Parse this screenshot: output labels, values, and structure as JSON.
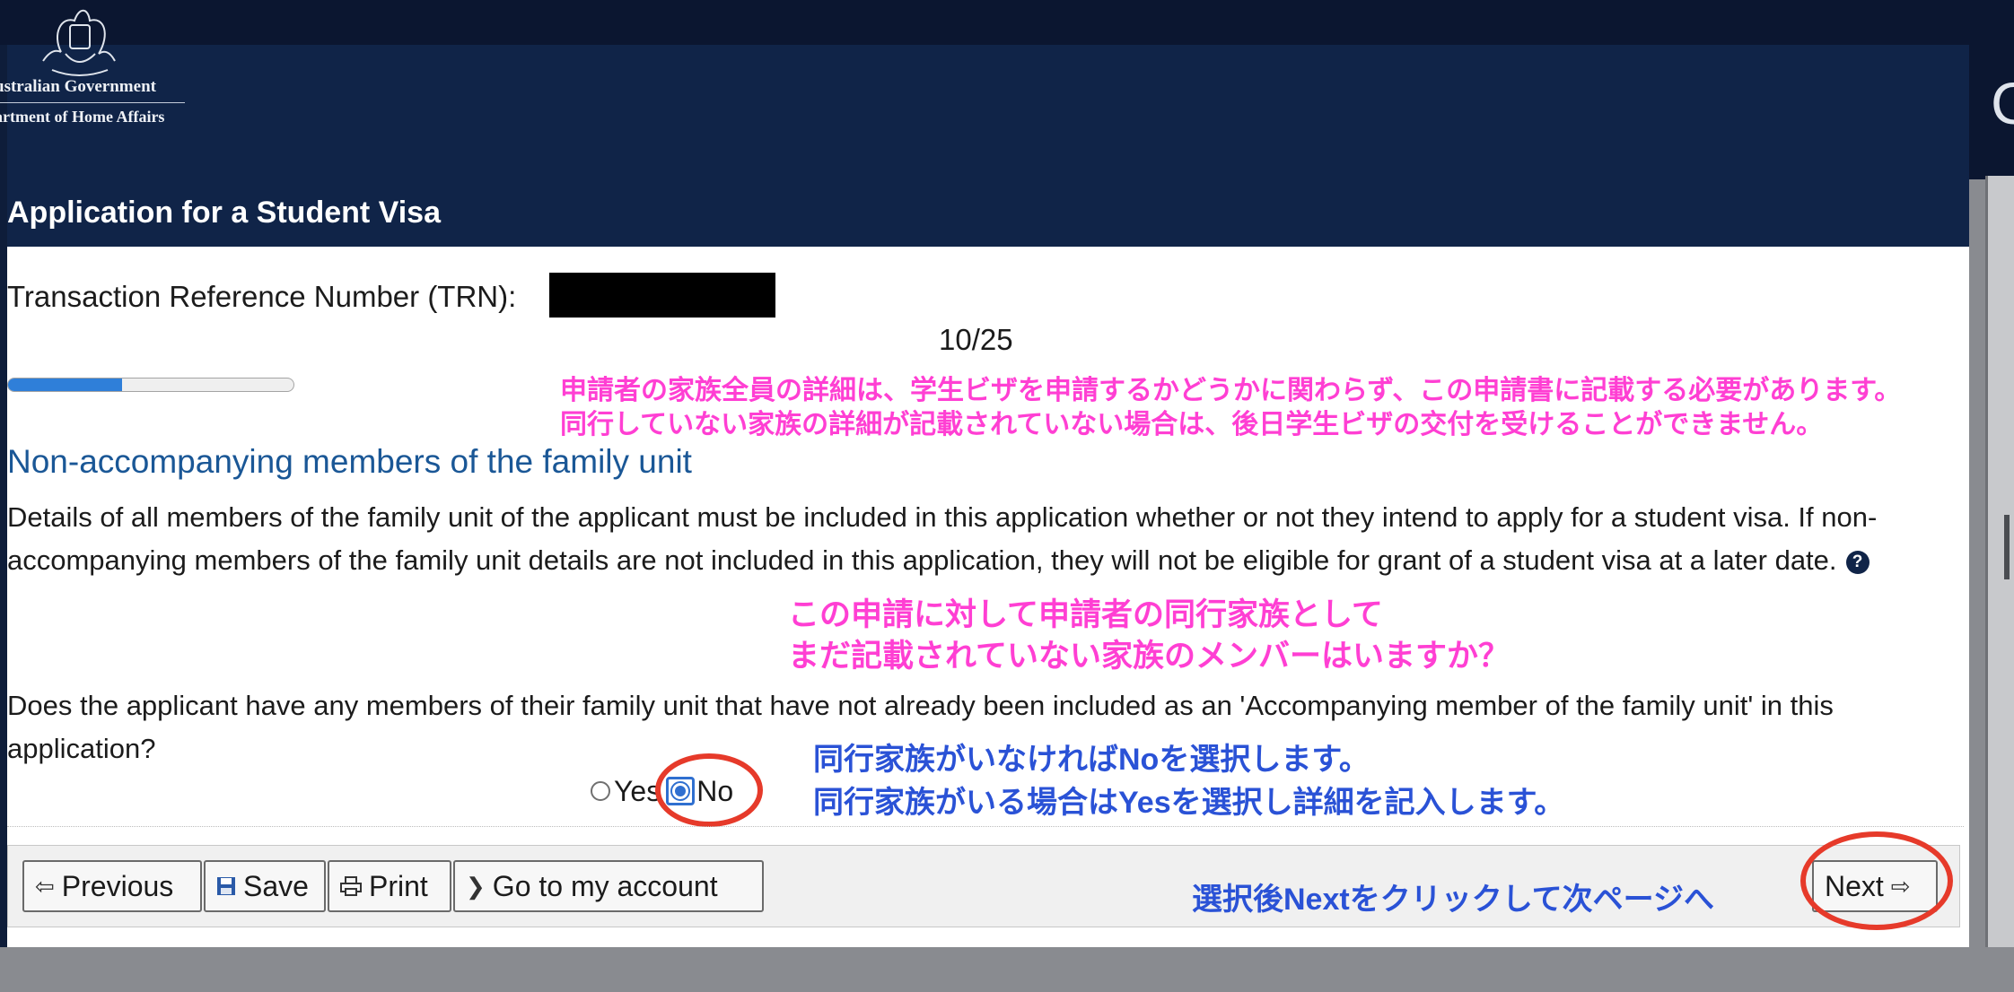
{
  "header": {
    "gov_line1": "ustralian Government",
    "gov_line2": "artment of Home Affairs",
    "app_title": "Application for a Student Visa"
  },
  "trn": {
    "label": "Transaction Reference Number (TRN):"
  },
  "progress": {
    "counter": "10/25",
    "fraction": 0.4
  },
  "annotations": {
    "pink1_line1": "申請者の家族全員の詳細は、学生ビザを申請するかどうかに関わらず、この申請書に記載する必要があります。",
    "pink1_line2": "同行していない家族の詳細が記載されていない場合は、後日学生ビザの交付を受けることができません。",
    "pink2_line1": "この申請に対して申請者の同行家族として",
    "pink2_line2": "まだ記載されていない家族のメンバーはいますか？",
    "blue1_line1": "同行家族がいなければNoを選択します。",
    "blue1_line2": "同行家族がいる場合はYesを選択し詳細を記入します。",
    "blue2": "選択後Nextをクリックして次ページへ"
  },
  "section": {
    "heading": "Non-accompanying members of the family unit",
    "description": "Details of all members of the family unit of the applicant must be included in this application whether or not they intend to apply for a student visa. If non-accompanying members of the family unit details are not included in this application, they will not be eligible for grant of a student visa at a later date.",
    "help_icon": "question-circle-icon"
  },
  "question": {
    "text": "Does the applicant have any members of their family unit that have not already been included as an 'Accompanying member of the family unit' in this application?",
    "options": [
      {
        "label": "Yes",
        "selected": false
      },
      {
        "label": "No",
        "selected": true
      }
    ]
  },
  "toolbar": {
    "previous_label": "Previous",
    "save_label": "Save",
    "print_label": "Print",
    "account_label": "Go to my account",
    "next_label": "Next"
  },
  "colors": {
    "header_bg": "#102448",
    "heading_blue": "#1a5796",
    "annotation_pink": "#ff3fd3",
    "annotation_blue": "#2a52d6",
    "highlight_ring": "#e63a2a",
    "progress_fill": "#2f7fd9"
  }
}
